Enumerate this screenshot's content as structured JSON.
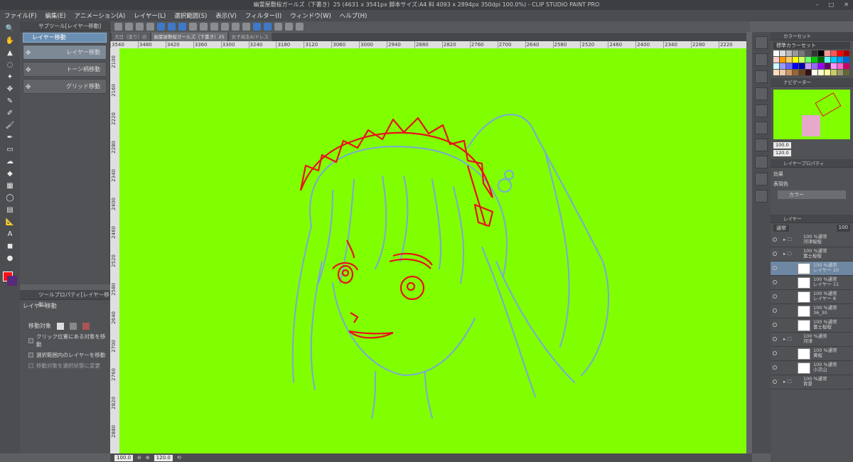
{
  "window": {
    "title": "幽霊屋敷桜ガールズ（下書き）25 (4631 x 3541px 脚本サイズ:A4 料 4093 x 2894px 350dpi 100.0%) - CLIP STUDIO PAINT PRO"
  },
  "menu": [
    "ファイル(F)",
    "編集(E)",
    "アニメーション(A)",
    "レイヤー(L)",
    "選択範囲(S)",
    "表示(V)",
    "フィルター(I)",
    "ウィンドウ(W)",
    "ヘルプ(H)"
  ],
  "doc_tabs": [
    "犬日（塗り）の",
    "幽霊屋敷桜ガールズ（下書き）25",
    "女子高生A/ドレス"
  ],
  "subtool": {
    "tab_label": "サブツール[レイヤー移動]",
    "header": "レイヤー移動",
    "items": [
      "レイヤー移動",
      "トーン柄移動",
      "グリッド移動"
    ]
  },
  "toolprop": {
    "tab_label": "ツールプロパティ[レイヤー移動]",
    "title": "レイヤー移動",
    "target_label": "移動対象",
    "options": [
      "クリック位置にある対象を移動",
      "選択範囲内のレイヤーを移動",
      "移動対象を選択状態に変更"
    ]
  },
  "ruler_top": [
    "3540",
    "3480",
    "3420",
    "3360",
    "3300",
    "3240",
    "3180",
    "3120",
    "3060",
    "3000",
    "2940",
    "2880",
    "2820",
    "2760",
    "2700",
    "2640",
    "2580",
    "2520",
    "2460",
    "2400",
    "2340",
    "2280",
    "2220"
  ],
  "ruler_left": [
    "2100",
    "2160",
    "2220",
    "2280",
    "2340",
    "2400",
    "2460",
    "2520",
    "2580",
    "2640",
    "2700",
    "2760",
    "2820",
    "2880"
  ],
  "status": {
    "zoom": "100.0",
    "angle": "120.0"
  },
  "right": {
    "color_set_tab": "カラーセット",
    "color_set_name": "標準カラーセット",
    "navigator_tab": "ナビゲーター",
    "nav_zoom": "100.0",
    "nav_angle": "120.0",
    "layer_prop_tab": "レイヤープロパティ",
    "effect_label": "効果",
    "expression_label": "表現色",
    "expression_value": "カラー",
    "layer_tab": "レイヤー",
    "blend_mode": "通常",
    "opacity": "100",
    "layers": [
      {
        "name": "100 %通常\n河津桜桜",
        "type": "folder"
      },
      {
        "name": "100 %通常\n富士桜桜",
        "type": "folder"
      },
      {
        "name": "100 %通常\nレイヤー 10",
        "type": "layer",
        "selected": true
      },
      {
        "name": "100 %通常\nレイヤー 11",
        "type": "layer"
      },
      {
        "name": "100 %通常\nレイヤー 8",
        "type": "layer"
      },
      {
        "name": "100 %通常\n36_30",
        "type": "layer"
      },
      {
        "name": "100 %通常\n富士桜桜",
        "type": "layer"
      },
      {
        "name": "100 %通常\n河津",
        "type": "folder"
      },
      {
        "name": "100 %通常\n黄桜",
        "type": "layer"
      },
      {
        "name": "100 %通常\n小次山",
        "type": "layer"
      },
      {
        "name": "100 %通常\n背景",
        "type": "folder"
      }
    ]
  },
  "colors": {
    "canvas_bg": "#80ff00",
    "sketch_blue": "#7aa8d8",
    "lineart_red": "#e8121a"
  }
}
